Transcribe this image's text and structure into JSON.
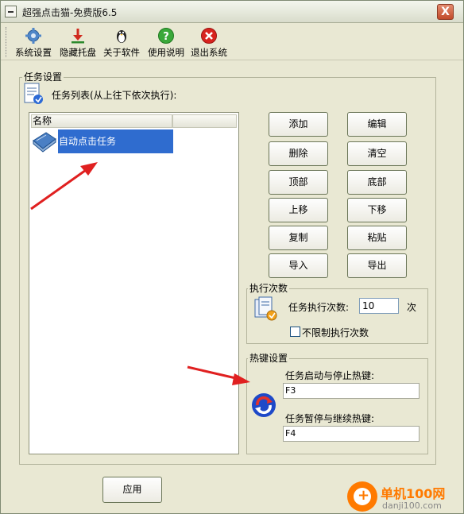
{
  "window": {
    "title": "超强点击猫-免费版6.5",
    "close_label": "X"
  },
  "toolbar": [
    {
      "label": "系统设置",
      "icon": "gear-icon"
    },
    {
      "label": "隐藏托盘",
      "icon": "tray-download-icon"
    },
    {
      "label": "关于软件",
      "icon": "penguin-icon"
    },
    {
      "label": "使用说明",
      "icon": "help-icon"
    },
    {
      "label": "退出系统",
      "icon": "exit-icon"
    }
  ],
  "task_group": {
    "title": "任务设置",
    "list_caption": "任务列表(从上往下依次执行):",
    "column_name": "名称",
    "rows": [
      {
        "name": "自动点击任务",
        "selected": true
      }
    ]
  },
  "buttons": {
    "add": "添加",
    "edit": "编辑",
    "delete": "删除",
    "clear": "清空",
    "top": "顶部",
    "bottom": "底部",
    "up": "上移",
    "down": "下移",
    "copy": "复制",
    "paste": "粘贴",
    "import": "导入",
    "export": "导出"
  },
  "exec_count": {
    "title": "执行次数",
    "label": "任务执行次数:",
    "value": "10",
    "unit": "次",
    "unlimited_label": "不限制执行次数",
    "unlimited_checked": false
  },
  "hotkeys": {
    "title": "热键设置",
    "start_stop_label": "任务启动与停止热键:",
    "start_stop_value": "F3",
    "pause_resume_label": "任务暂停与继续热键:",
    "pause_resume_value": "F4"
  },
  "apply_label": "应用",
  "watermark": {
    "main": "单机100网",
    "sub": "danji100.com"
  },
  "colors": {
    "selection": "#2f6ccf",
    "arrow": "#e02020",
    "window_bg": "#e9e8d3"
  }
}
